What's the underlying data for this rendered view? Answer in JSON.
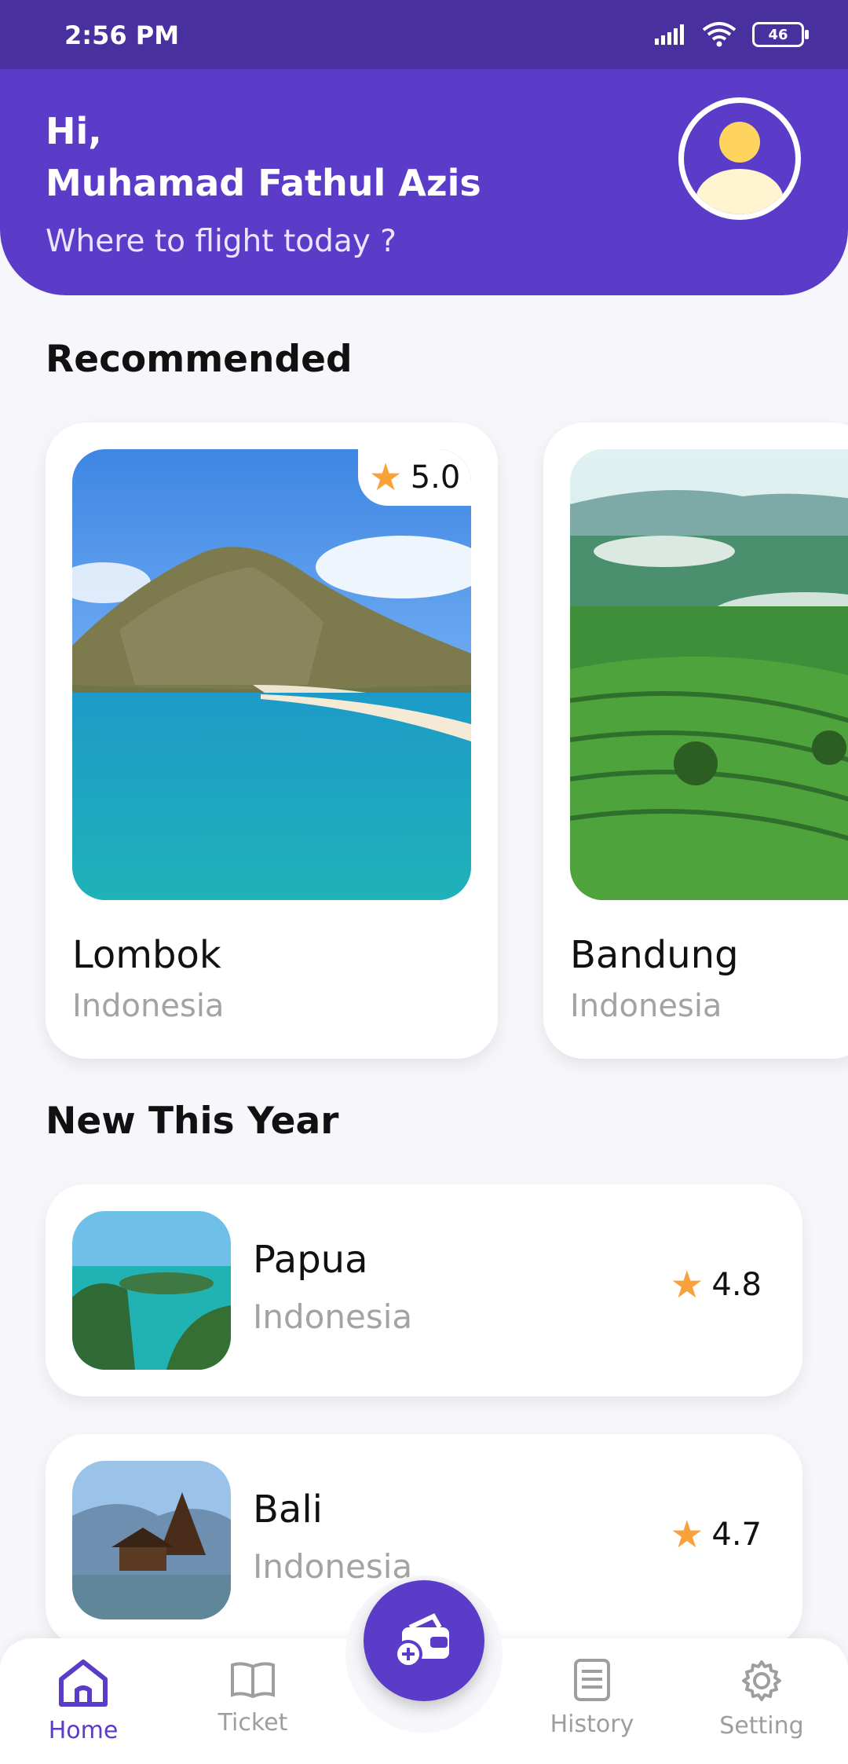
{
  "status_bar": {
    "time": "2:56 PM",
    "battery": "46"
  },
  "header": {
    "greeting": "Hi,",
    "user_name": "Muhamad Fathul Azis",
    "subtitle": "Where to flight today ?"
  },
  "recommended": {
    "title": "Recommended",
    "items": [
      {
        "name": "Lombok",
        "country": "Indonesia",
        "rating": "5.0"
      },
      {
        "name": "Bandung",
        "country": "Indonesia"
      }
    ]
  },
  "new_this_year": {
    "title": "New This Year",
    "items": [
      {
        "name": "Papua",
        "country": "Indonesia",
        "rating": "4.8"
      },
      {
        "name": "Bali",
        "country": "Indonesia",
        "rating": "4.7"
      }
    ]
  },
  "bottom_nav": {
    "items": [
      {
        "label": "Home",
        "icon": "home-icon",
        "active": true
      },
      {
        "label": "Ticket",
        "icon": "ticket-icon",
        "active": false
      },
      {
        "label": "History",
        "icon": "history-icon",
        "active": false
      },
      {
        "label": "Setting",
        "icon": "settings-icon",
        "active": false
      }
    ],
    "fab_icon": "wallet-plus-icon"
  },
  "colors": {
    "primary": "#5B3CC8",
    "status_bar": "#48309E",
    "star": "#F9A23B",
    "muted_text": "#A3A3A3"
  }
}
